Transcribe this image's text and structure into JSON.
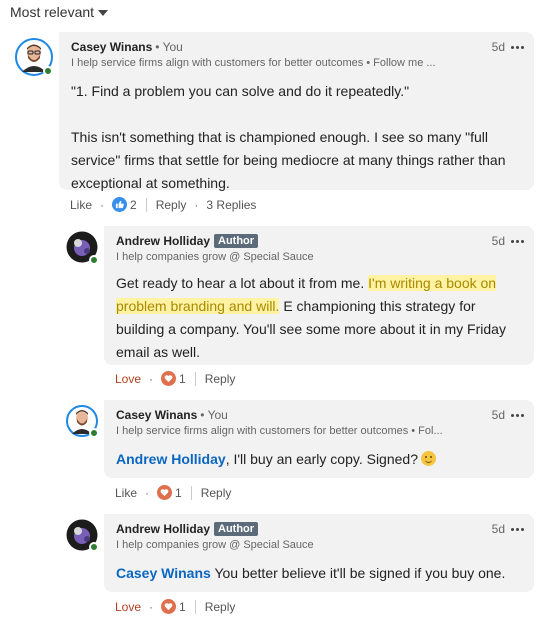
{
  "sort": {
    "label": "Most relevant",
    "icon": "caret-down-icon"
  },
  "comments": [
    {
      "author": "Casey Winans",
      "you_label": "• You",
      "headline": "I help service firms align with customers for better outcomes • Follow me ...",
      "time": "5d",
      "body_1": "\"1. Find a problem you can solve and do it repeatedly.\"",
      "body_2": "This isn't something that is championed enough. I see so many \"full service\" firms that settle for being mediocre at many things rather than exceptional at something.",
      "actions": {
        "reaction": "Like",
        "reaction_count": "2",
        "reply": "Reply",
        "replies": "3 Replies"
      }
    },
    {
      "author": "Andrew Holliday",
      "badge": "Author",
      "headline": "I help companies grow @ Special Sauce",
      "time": "5d",
      "body_pre": "Get ready to hear a lot about it from me. ",
      "body_highlight": "I'm writing a book on problem branding and will.",
      "body_post": " E championing this strategy for building a company. You'll see some more about it in my Friday email as well.",
      "actions": {
        "reaction": "Love",
        "reaction_count": "1",
        "reply": "Reply"
      }
    },
    {
      "author": "Casey Winans",
      "you_label": "• You",
      "headline": "I help service firms align with customers for better outcomes • Fol...",
      "time": "5d",
      "mention": "Andrew Holliday",
      "body": ", I'll buy an early copy. Signed?",
      "actions": {
        "reaction": "Like",
        "reaction_count": "1",
        "reply": "Reply"
      }
    },
    {
      "author": "Andrew Holliday",
      "badge": "Author",
      "headline": "I help companies grow @ Special Sauce",
      "time": "5d",
      "mention": "Casey Winans",
      "body": " You better believe it'll be signed if you buy one.",
      "actions": {
        "reaction": "Love",
        "reaction_count": "1",
        "reply": "Reply"
      }
    }
  ],
  "colors": {
    "link": "#0a66c2",
    "love": "#b24020",
    "online": "#2e7d32",
    "bubble": "#f2f2f2",
    "highlight": "#fff3a3"
  }
}
